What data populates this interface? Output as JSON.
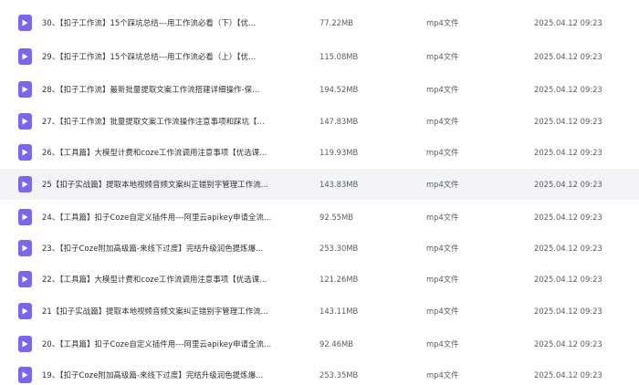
{
  "colors": {
    "icon_purple": "#7b66f0",
    "row_highlight": "#f3f4f7"
  },
  "files": [
    {
      "name": "30、【扣子工作流】15个踩坑总结---用工作流必看（下）【优...",
      "size": "77.22MB",
      "type": "mp4文件",
      "date": "2025.04.12 09:23",
      "icon": "video-file-icon"
    },
    {
      "name": "29、【扣子工作流】15个踩坑总结---用工作流必看（上）【优...",
      "size": "115.08MB",
      "type": "mp4文件",
      "date": "2025.04.12 09:23",
      "icon": "video-file-icon"
    },
    {
      "name": "28、【扣子工作流】最新批量提取文案工作流搭建详细操作-保...",
      "size": "194.52MB",
      "type": "mp4文件",
      "date": "2025.04.12 09:23",
      "icon": "video-file-icon"
    },
    {
      "name": "27、【扣子工作流】批量提取文案工作流操作注意事项和踩坑【...",
      "size": "147.83MB",
      "type": "mp4文件",
      "date": "2025.04.12 09:23",
      "icon": "video-file-icon"
    },
    {
      "name": "26、【工具篇】大模型计费和coze工作流调用注意事项【优选课...",
      "size": "119.93MB",
      "type": "mp4文件",
      "date": "2025.04.12 09:23",
      "icon": "video-file-icon"
    },
    {
      "name": "25【扣子实战篇】提取本地视频音频文案纠正错别字管理工作流...",
      "size": "143.83MB",
      "type": "mp4文件",
      "date": "2025.04.12 09:23",
      "icon": "video-file-icon"
    },
    {
      "name": "24、【工具篇】扣子Coze自定义插件用---阿里云apikey申请全流...",
      "size": "92.55MB",
      "type": "mp4文件",
      "date": "2025.04.12 09:23",
      "icon": "video-file-icon"
    },
    {
      "name": "23、【扣子Coze附加高级篇-来线下过度】完结升级润色提炼爆...",
      "size": "253.30MB",
      "type": "mp4文件",
      "date": "2025.04.12 09:23",
      "icon": "video-file-icon"
    },
    {
      "name": "22、【工具篇】大模型计费和coze工作流调用注意事项【优选课...",
      "size": "121.26MB",
      "type": "mp4文件",
      "date": "2025.04.12 09:23",
      "icon": "video-file-icon"
    },
    {
      "name": "21【扣子实战篇】提取本地视频音频文案纠正错别字管理工作流...",
      "size": "143.11MB",
      "type": "mp4文件",
      "date": "2025.04.12 09:23",
      "icon": "video-file-icon"
    },
    {
      "name": "20、【工具篇】扣子Coze自定义插件用---阿里云apikey申请全流...",
      "size": "92.46MB",
      "type": "mp4文件",
      "date": "2025.04.12 09:23",
      "icon": "video-file-icon"
    },
    {
      "name": "19、【扣子Coze附加高级篇-来线下过度】完结升级润色提炼爆...",
      "size": "253.35MB",
      "type": "mp4文件",
      "date": "2025.04.12 09:23",
      "icon": "video-file-icon"
    }
  ]
}
